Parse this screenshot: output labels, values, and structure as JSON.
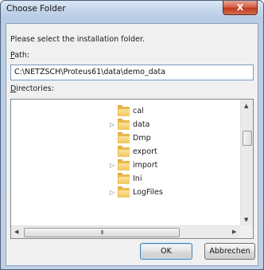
{
  "window": {
    "title": "Choose Folder",
    "close_glyph": "X"
  },
  "prompt": "Please select the installation folder.",
  "path": {
    "label_accel": "P",
    "label_rest": "ath:",
    "value": "C:\\NETZSCH\\Proteus61\\data\\demo_data"
  },
  "directories": {
    "label_accel": "D",
    "label_rest": "irectories:",
    "items": [
      {
        "label": "cal",
        "expandable": false
      },
      {
        "label": "data",
        "expandable": true
      },
      {
        "label": "Dmp",
        "expandable": false
      },
      {
        "label": "export",
        "expandable": false
      },
      {
        "label": "import",
        "expandable": true
      },
      {
        "label": "Ini",
        "expandable": false
      },
      {
        "label": "LogFiles",
        "expandable": true
      }
    ]
  },
  "scroll": {
    "up": "▲",
    "down": "▼",
    "left": "◀",
    "right": "▶",
    "grip": "III"
  },
  "buttons": {
    "ok": "OK",
    "cancel": "Abbrechen"
  },
  "colors": {
    "folder": "#e9b94a",
    "close": "#c0391d",
    "default_button_border": "#3c7fb1"
  }
}
